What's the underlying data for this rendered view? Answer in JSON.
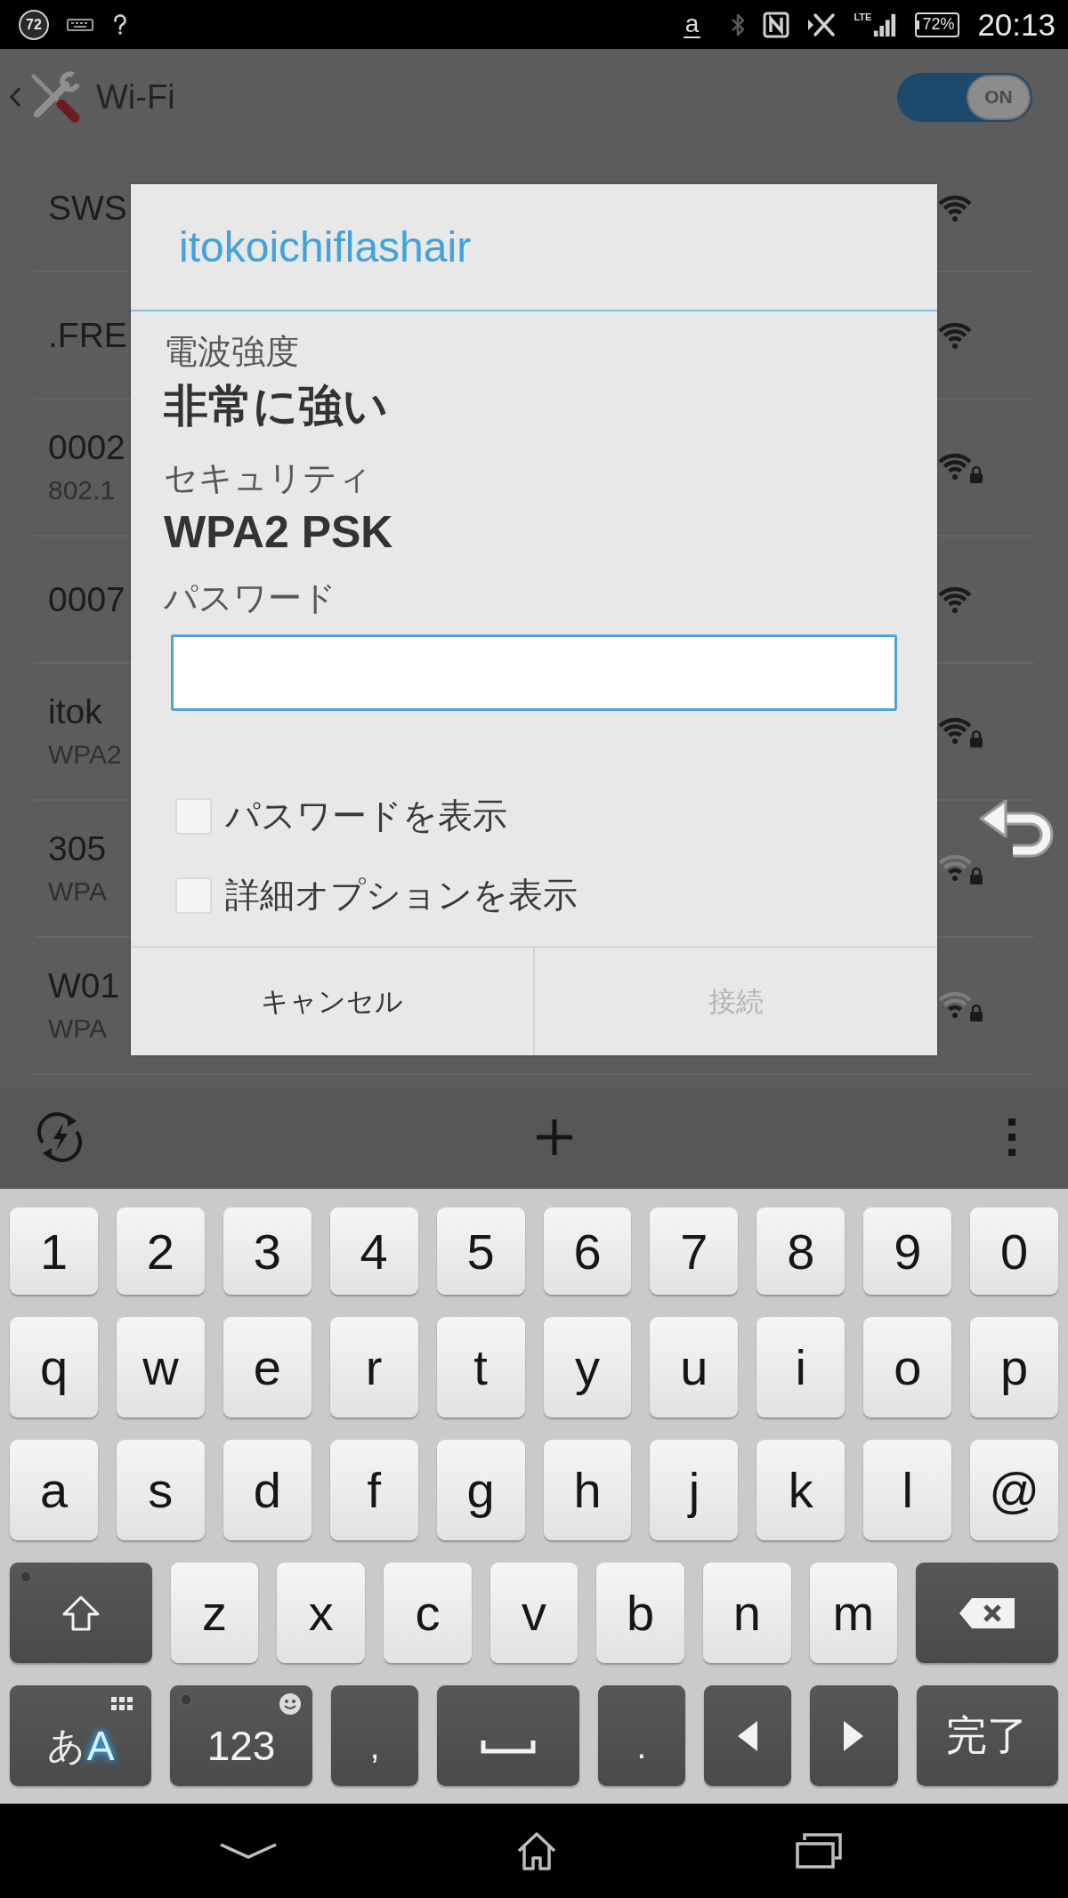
{
  "status_bar": {
    "notification_count": "72",
    "store_letter": "a",
    "network_type": "LTE",
    "battery": "72%",
    "time": "20:13"
  },
  "action_bar": {
    "title": "Wi-Fi",
    "wifi_switch": {
      "label": "ON",
      "on": true
    }
  },
  "networks": [
    {
      "name": "SWS",
      "secured": false,
      "weak": false
    },
    {
      "name": ".FRE",
      "secured": false,
      "weak": false
    },
    {
      "name": "0002",
      "security": "802.1",
      "secured": true,
      "weak": false
    },
    {
      "name": "0007",
      "secured": false,
      "weak": false
    },
    {
      "name": "itok",
      "security": "WPA2",
      "secured": true,
      "weak": false
    },
    {
      "name": "305",
      "security": "WPA",
      "secured": true,
      "weak": true
    },
    {
      "name": "W01",
      "security": "WPA",
      "secured": true,
      "weak": true
    }
  ],
  "dialog": {
    "title": "itokoichiflashair",
    "details": [
      {
        "label": "電波強度",
        "value": "非常に強い"
      },
      {
        "label": "セキュリティ",
        "value": "WPA2 PSK"
      }
    ],
    "password": {
      "label": "パスワード",
      "focused": true
    },
    "options": [
      {
        "label": "パスワードを表示",
        "checked": false
      },
      {
        "label": "詳細オプションを表示",
        "checked": false
      }
    ],
    "buttons": [
      {
        "label": "キャンセル",
        "disabled": false
      },
      {
        "label": "接続",
        "disabled": true
      }
    ]
  },
  "keyboard": {
    "rows": [
      {
        "keys": [
          {
            "kind": "char",
            "label": "1"
          },
          {
            "kind": "char",
            "label": "2"
          },
          {
            "kind": "char",
            "label": "3"
          },
          {
            "kind": "char",
            "label": "4"
          },
          {
            "kind": "char",
            "label": "5"
          },
          {
            "kind": "char",
            "label": "6"
          },
          {
            "kind": "char",
            "label": "7"
          },
          {
            "kind": "char",
            "label": "8"
          },
          {
            "kind": "char",
            "label": "9"
          },
          {
            "kind": "char",
            "label": "0"
          }
        ]
      },
      {
        "keys": [
          {
            "kind": "char",
            "label": "q"
          },
          {
            "kind": "char",
            "label": "w"
          },
          {
            "kind": "char",
            "label": "e"
          },
          {
            "kind": "char",
            "label": "r"
          },
          {
            "kind": "char",
            "label": "t"
          },
          {
            "kind": "char",
            "label": "y"
          },
          {
            "kind": "char",
            "label": "u"
          },
          {
            "kind": "char",
            "label": "i"
          },
          {
            "kind": "char",
            "label": "o"
          },
          {
            "kind": "char",
            "label": "p"
          }
        ]
      },
      {
        "keys": [
          {
            "kind": "char",
            "label": "a"
          },
          {
            "kind": "char",
            "label": "s"
          },
          {
            "kind": "char",
            "label": "d"
          },
          {
            "kind": "char",
            "label": "f"
          },
          {
            "kind": "char",
            "label": "g"
          },
          {
            "kind": "char",
            "label": "h"
          },
          {
            "kind": "char",
            "label": "j"
          },
          {
            "kind": "char",
            "label": "k"
          },
          {
            "kind": "char",
            "label": "l"
          },
          {
            "kind": "char",
            "label": "@"
          }
        ]
      },
      {
        "keys": [
          {
            "kind": "shift"
          },
          {
            "kind": "char",
            "label": "z"
          },
          {
            "kind": "char",
            "label": "x"
          },
          {
            "kind": "char",
            "label": "c"
          },
          {
            "kind": "char",
            "label": "v"
          },
          {
            "kind": "char",
            "label": "b"
          },
          {
            "kind": "char",
            "label": "n"
          },
          {
            "kind": "char",
            "label": "m"
          },
          {
            "kind": "backspace"
          }
        ]
      },
      {
        "keys": [
          {
            "kind": "input_mode",
            "options": [
              {
                "label": "あ",
                "selected": false
              },
              {
                "label": "A",
                "selected": true
              }
            ]
          },
          {
            "kind": "symbols",
            "label": "123"
          },
          {
            "kind": "punct",
            "label": ","
          },
          {
            "kind": "space"
          },
          {
            "kind": "punct",
            "label": "."
          },
          {
            "kind": "cursor_left"
          },
          {
            "kind": "cursor_right"
          },
          {
            "kind": "done",
            "label": "完了"
          }
        ]
      }
    ]
  }
}
